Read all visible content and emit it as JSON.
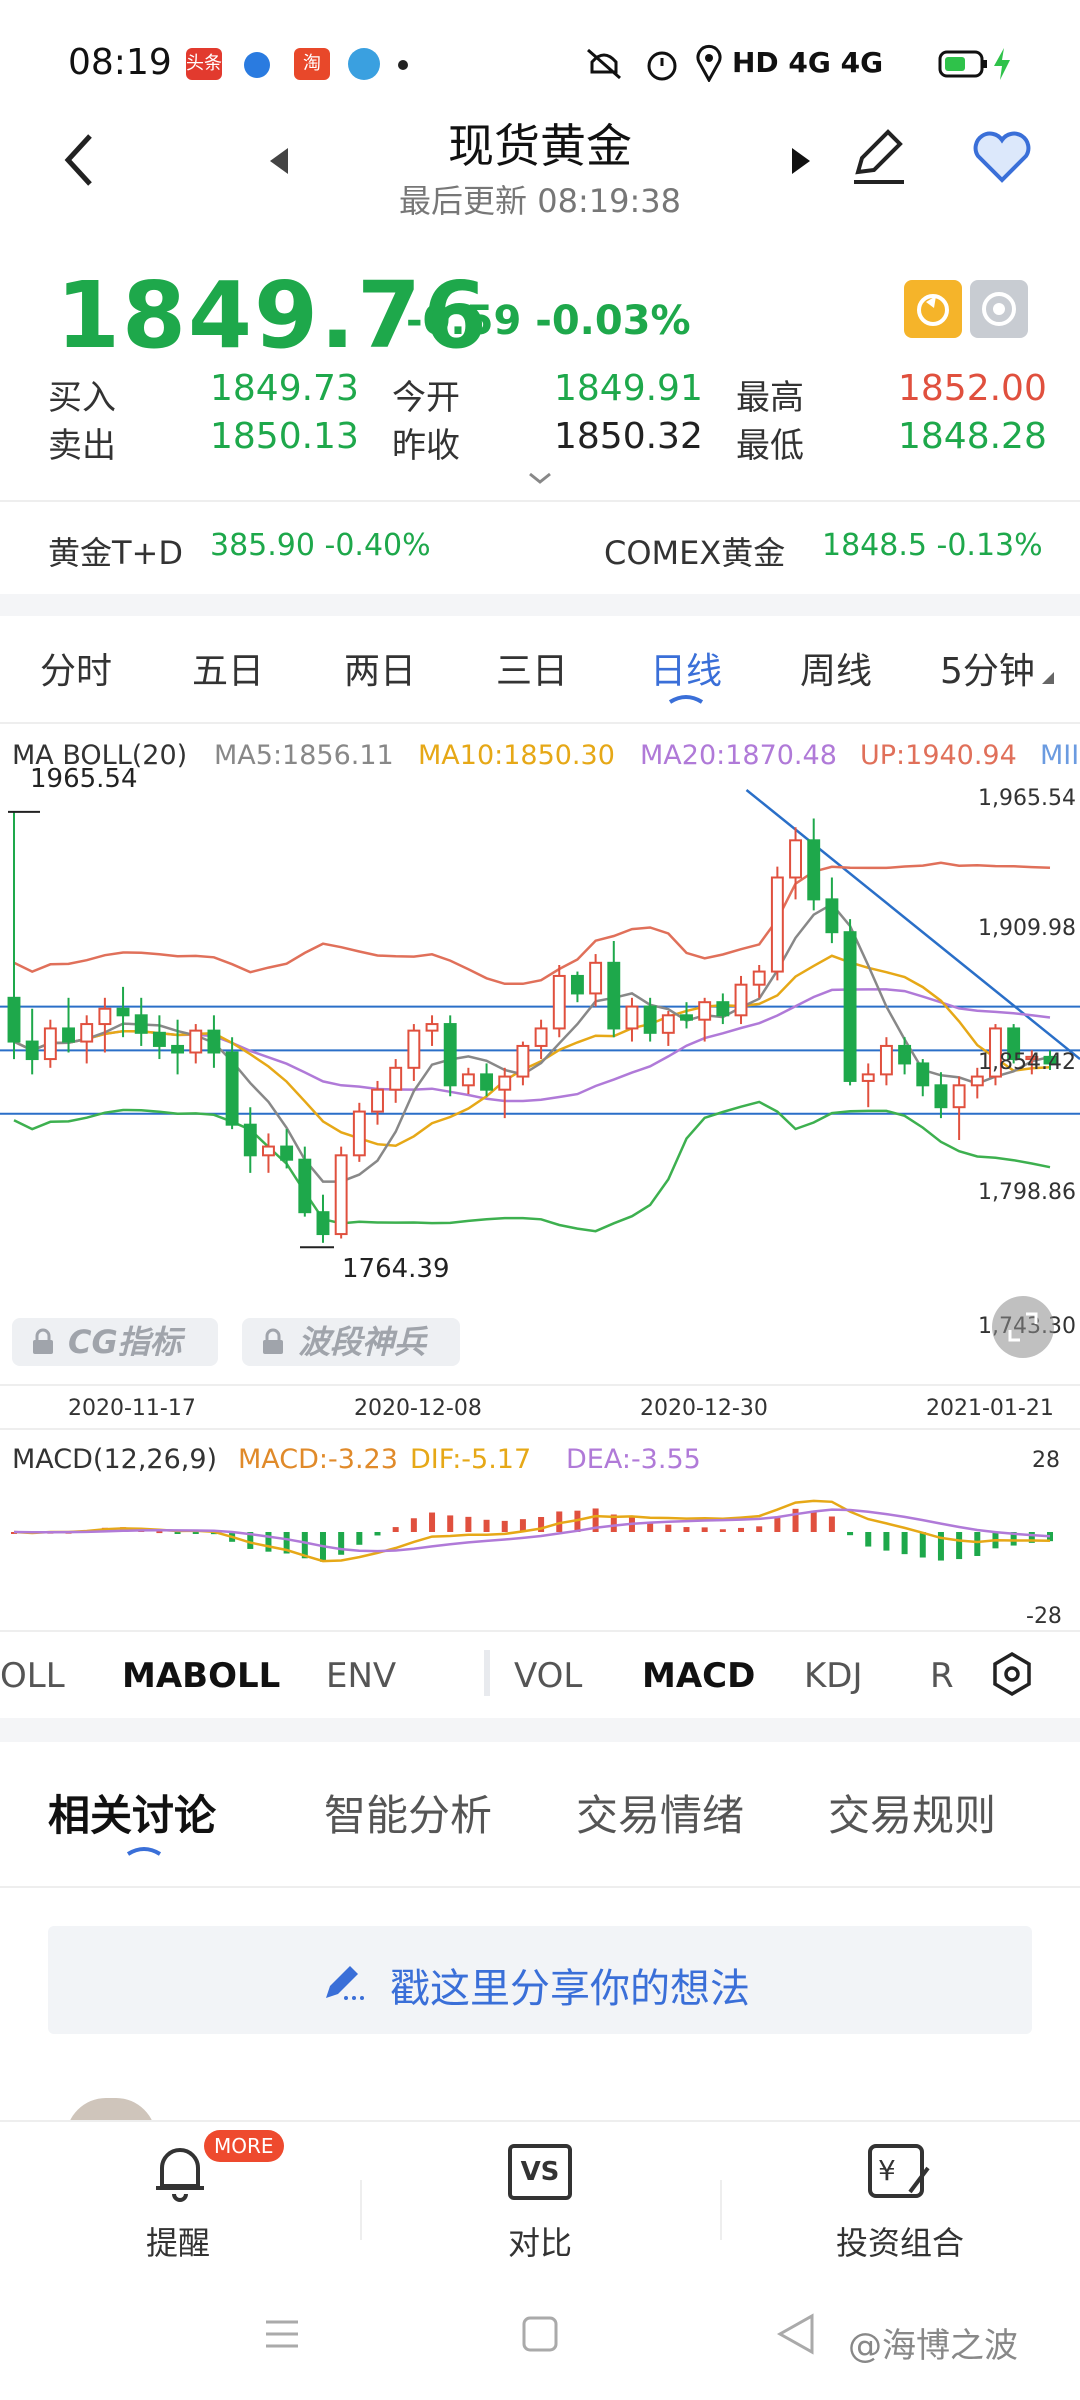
{
  "status_bar": {
    "time": "08:19",
    "network": "HD 4G 4G",
    "icons": [
      "toutiao-icon",
      "browser-icon",
      "taobao-icon",
      "app-icon",
      "mute-icon",
      "alarm-icon",
      "location-icon",
      "signal-icon",
      "battery-icon"
    ],
    "toutiao_label": "头条",
    "taobao_label": "淘"
  },
  "header": {
    "title": "现货黄金",
    "subtitle": "最后更新  08:19:38"
  },
  "quote": {
    "price": "1849.76",
    "change": "-0.59 -0.03%",
    "buy_label": "买入",
    "buy": "1849.73",
    "sell_label": "卖出",
    "sell": "1850.13",
    "open_label": "今开",
    "open": "1849.91",
    "prev_label": "昨收",
    "prev": "1850.32",
    "high_label": "最高",
    "high": "1852.00",
    "low_label": "最低",
    "low": "1848.28"
  },
  "related": {
    "left_name": "黄金T+D",
    "left_val": "385.90 -0.40%",
    "right_name": "COMEX黄金",
    "right_val": "1848.5 -0.13%"
  },
  "kline_tabs": [
    "分时",
    "五日",
    "两日",
    "三日",
    "日线",
    "周线",
    "5分钟"
  ],
  "active_kline_tab": "日线",
  "chart_legend": {
    "name": "MA BOLL(20)",
    "ma5": "MA5:1856.11",
    "ma10": "MA10:1850.30",
    "ma20": "MA20:1870.48",
    "up": "UP:1940.94",
    "mid": "MII"
  },
  "chart_axis": {
    "y_top": "1,965.54",
    "y_2": "1,909.98",
    "y_3": "1,854.42",
    "y_4": "1,798.86",
    "y_5": "1,743.30",
    "max_label": "1965.54",
    "min_label": "1764.39"
  },
  "chart_dates": [
    "2020-11-17",
    "2020-12-08",
    "2020-12-30",
    "2021-01-21"
  ],
  "locked_indicators": [
    "CG指标",
    "波段神兵"
  ],
  "macd": {
    "name": "MACD(12,26,9)",
    "macd": "MACD:-3.23",
    "dif": "DIF:-5.17",
    "dea": "DEA:-3.55",
    "top": "28",
    "bottom": "-28"
  },
  "indicator_tabs": {
    "left": [
      "OLL",
      "MABOLL",
      "ENV"
    ],
    "right": [
      "VOL",
      "MACD",
      "KDJ",
      "R"
    ]
  },
  "discussion_tabs": [
    "相关讨论",
    "智能分析",
    "交易情绪",
    "交易规则"
  ],
  "share_placeholder": "戳这里分享你的想法",
  "bottom_nav": {
    "remind": "提醒",
    "more_badge": "MORE",
    "compare": "对比",
    "vs_label": "VS",
    "portfolio": "投资组合"
  },
  "watermark": "@海博之波",
  "colors": {
    "up": "#e0503e",
    "down": "#1ea84b",
    "accent": "#3a6fd8",
    "ma5": "#888888",
    "ma10": "#e6a817",
    "ma20": "#b07ad8",
    "boll_up": "#e0705a",
    "boll_low": "#3db04f"
  },
  "chart_data": {
    "type": "candlestick",
    "xlabel": "",
    "ylabel": "",
    "ylim": [
      1735,
      1975
    ],
    "x_ticks": [
      "2020-11-17",
      "2020-12-08",
      "2020-12-30",
      "2021-01-21"
    ],
    "candles_ohlc": [
      [
        1880,
        1965,
        1852,
        1860
      ],
      [
        1860,
        1875,
        1845,
        1852
      ],
      [
        1852,
        1870,
        1848,
        1866
      ],
      [
        1866,
        1880,
        1855,
        1860
      ],
      [
        1860,
        1872,
        1850,
        1868
      ],
      [
        1868,
        1880,
        1855,
        1875
      ],
      [
        1875,
        1885,
        1862,
        1872
      ],
      [
        1872,
        1880,
        1858,
        1864
      ],
      [
        1864,
        1872,
        1852,
        1858
      ],
      [
        1858,
        1870,
        1845,
        1855
      ],
      [
        1855,
        1868,
        1850,
        1865
      ],
      [
        1865,
        1872,
        1848,
        1855
      ],
      [
        1855,
        1862,
        1820,
        1822
      ],
      [
        1822,
        1830,
        1800,
        1808
      ],
      [
        1808,
        1818,
        1800,
        1812
      ],
      [
        1812,
        1820,
        1802,
        1806
      ],
      [
        1806,
        1812,
        1780,
        1782
      ],
      [
        1782,
        1790,
        1768,
        1772
      ],
      [
        1772,
        1812,
        1770,
        1808
      ],
      [
        1808,
        1832,
        1805,
        1828
      ],
      [
        1828,
        1842,
        1822,
        1838
      ],
      [
        1838,
        1852,
        1832,
        1848
      ],
      [
        1848,
        1868,
        1842,
        1865
      ],
      [
        1865,
        1872,
        1858,
        1868
      ],
      [
        1868,
        1872,
        1835,
        1840
      ],
      [
        1840,
        1848,
        1836,
        1845
      ],
      [
        1845,
        1850,
        1835,
        1838
      ],
      [
        1838,
        1848,
        1825,
        1844
      ],
      [
        1844,
        1860,
        1840,
        1858
      ],
      [
        1858,
        1870,
        1852,
        1866
      ],
      [
        1866,
        1895,
        1862,
        1890
      ],
      [
        1890,
        1892,
        1878,
        1882
      ],
      [
        1882,
        1900,
        1876,
        1896
      ],
      [
        1896,
        1906,
        1862,
        1866
      ],
      [
        1866,
        1880,
        1860,
        1876
      ],
      [
        1876,
        1880,
        1860,
        1864
      ],
      [
        1864,
        1874,
        1858,
        1872
      ],
      [
        1872,
        1878,
        1866,
        1870
      ],
      [
        1870,
        1880,
        1860,
        1878
      ],
      [
        1878,
        1882,
        1868,
        1872
      ],
      [
        1872,
        1890,
        1868,
        1886
      ],
      [
        1886,
        1895,
        1880,
        1892
      ],
      [
        1892,
        1940,
        1888,
        1935
      ],
      [
        1935,
        1958,
        1925,
        1952
      ],
      [
        1952,
        1962,
        1920,
        1925
      ],
      [
        1925,
        1935,
        1905,
        1910
      ],
      [
        1910,
        1916,
        1840,
        1842
      ],
      [
        1842,
        1850,
        1830,
        1845
      ],
      [
        1845,
        1862,
        1840,
        1858
      ],
      [
        1858,
        1862,
        1845,
        1850
      ],
      [
        1850,
        1852,
        1835,
        1840
      ],
      [
        1840,
        1846,
        1825,
        1830
      ],
      [
        1830,
        1844,
        1815,
        1840
      ],
      [
        1840,
        1848,
        1834,
        1844
      ],
      [
        1844,
        1868,
        1840,
        1866
      ],
      [
        1866,
        1868,
        1850,
        1852
      ],
      [
        1852,
        1856,
        1845,
        1853
      ],
      [
        1853,
        1856,
        1847,
        1850
      ]
    ]
  }
}
